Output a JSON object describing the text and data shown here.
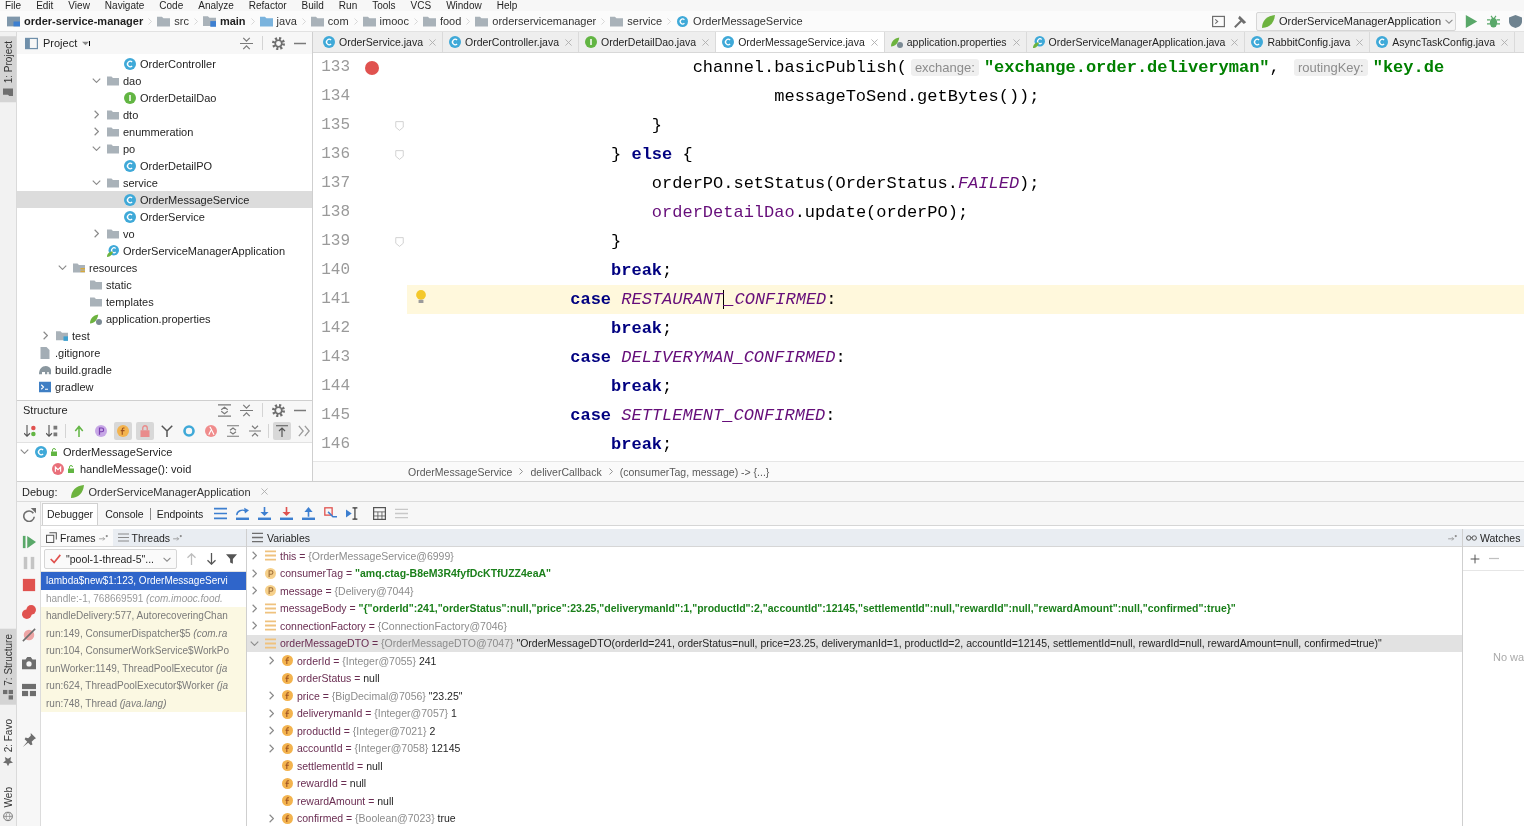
{
  "menu_bar": {
    "items": [
      "File",
      "Edit",
      "View",
      "Navigate",
      "Code",
      "Analyze",
      "Refactor",
      "Build",
      "Run",
      "Tools",
      "VCS",
      "Window",
      "Help"
    ]
  },
  "nav_bar": {
    "breadcrumbs": [
      {
        "label": "order-service-manager",
        "kind": "project"
      },
      {
        "label": "src",
        "kind": "package"
      },
      {
        "label": "main",
        "kind": "module"
      },
      {
        "label": "java",
        "kind": "source"
      },
      {
        "label": "com",
        "kind": "package"
      },
      {
        "label": "imooc",
        "kind": "package"
      },
      {
        "label": "food",
        "kind": "package"
      },
      {
        "label": "orderservicemanager",
        "kind": "package"
      },
      {
        "label": "service",
        "kind": "package"
      },
      {
        "label": "OrderMessageService",
        "kind": "class"
      }
    ],
    "run_config": "OrderServiceManagerApplication"
  },
  "tool_stripes": {
    "top": [
      {
        "label": "1: Project",
        "kind": "project",
        "selected": true
      }
    ],
    "bottom": [
      {
        "label": "7: Structure",
        "kind": "structure",
        "selected": true
      },
      {
        "label": "2: Favo",
        "kind": "favorites",
        "selected": false
      },
      {
        "label": "Web",
        "kind": "web",
        "selected": false
      }
    ]
  },
  "project_panel": {
    "title": "Project",
    "tree": [
      {
        "children": [
          {
            "children": [
              {
                "children": [
                  {
                    "children": [
                      {
                        "children": [
                          {
                            "label": "OrderController",
                            "kind": "class",
                            "selected": false
                          }
                        ]
                      },
                      {
                        "label": "dao",
                        "kind": "folder",
                        "expanded": true,
                        "selected": false,
                        "children": [
                          {
                            "label": "OrderDetailDao",
                            "kind": "interface",
                            "selected": false
                          }
                        ]
                      },
                      {
                        "label": "dto",
                        "kind": "folder",
                        "expanded": false,
                        "selected": false
                      },
                      {
                        "label": "enummeration",
                        "kind": "folder",
                        "expanded": false,
                        "selected": false
                      },
                      {
                        "label": "po",
                        "kind": "folder",
                        "expanded": true,
                        "selected": false,
                        "children": [
                          {
                            "label": "OrderDetailPO",
                            "kind": "class",
                            "selected": false
                          }
                        ]
                      },
                      {
                        "label": "service",
                        "kind": "folder",
                        "expanded": true,
                        "selected": false,
                        "children": [
                          {
                            "label": "OrderMessageService",
                            "kind": "class",
                            "selected": true
                          },
                          {
                            "label": "OrderService",
                            "kind": "class",
                            "selected": false
                          }
                        ]
                      },
                      {
                        "label": "vo",
                        "kind": "folder",
                        "expanded": false,
                        "selected": false
                      },
                      {
                        "label": "OrderServiceManagerApplication",
                        "kind": "application",
                        "selected": false
                      }
                    ]
                  }
                ]
              },
              {
                "label": "resources",
                "kind": "resources",
                "expanded": true,
                "selected": false,
                "children": [
                  {
                    "label": "static",
                    "kind": "folder",
                    "selected": false
                  },
                  {
                    "label": "templates",
                    "kind": "folder",
                    "selected": false
                  },
                  {
                    "label": "application.properties",
                    "kind": "properties",
                    "selected": false
                  }
                ]
              }
            ]
          },
          {
            "label": "test",
            "kind": "tests",
            "expanded": false,
            "selected": false
          }
        ]
      },
      {
        "label": ".gitignore",
        "kind": "text",
        "selected": false
      },
      {
        "label": "build.gradle",
        "kind": "gradle",
        "selected": false
      },
      {
        "label": "gradlew",
        "kind": "script",
        "selected": false
      }
    ]
  },
  "structure_panel": {
    "title": "Structure",
    "toolbar": [
      {
        "kind": "visibility",
        "on": false
      },
      {
        "kind": "alphabetical",
        "on": false
      },
      {
        "kind": "inherited",
        "on": false
      },
      {
        "kind": "properties",
        "on": false
      },
      {
        "kind": "fields",
        "on": true
      },
      {
        "kind": "nonpublic",
        "on": true
      },
      {
        "kind": "anonymous",
        "on": false
      },
      {
        "kind": "interfaces",
        "on": false
      },
      {
        "kind": "lambdas",
        "on": false
      },
      {
        "kind": "expand",
        "on": false
      },
      {
        "kind": "collapse",
        "on": false
      },
      {
        "kind": "autoscroll",
        "on": true
      },
      {
        "kind": "more",
        "on": false
      }
    ],
    "tree": [
      {
        "label": "OrderMessageService",
        "kind": "class",
        "expanded": true,
        "selected": false,
        "children": [
          {
            "label": "handleMessage(): void",
            "kind": "method",
            "selected": false
          }
        ]
      }
    ]
  },
  "editor": {
    "tabs": [
      {
        "label": "OrderService.java",
        "kind": "class",
        "selected": false
      },
      {
        "label": "OrderController.java",
        "kind": "class",
        "selected": false
      },
      {
        "label": "OrderDetailDao.java",
        "kind": "interface",
        "selected": false
      },
      {
        "label": "OrderMessageService.java",
        "kind": "class",
        "selected": true
      },
      {
        "label": "application.properties",
        "kind": "properties",
        "selected": false
      },
      {
        "label": "OrderServiceManagerApplication.java",
        "kind": "application",
        "selected": false
      },
      {
        "label": "RabbitConfig.java",
        "kind": "class",
        "selected": false
      },
      {
        "label": "AsyncTaskConfig.java",
        "kind": "class",
        "selected": false
      }
    ],
    "lines": [
      {
        "number": "133",
        "breakpoint": true,
        "fold": false,
        "current": false,
        "intention": false,
        "tokens": [
          {
            "text": "                            channel.basicPublish(",
            "kind": "plain"
          },
          {
            "text": "exchange:",
            "kind": "hint"
          },
          {
            "text": "\"exchange.order.deliveryman\"",
            "kind": "string"
          },
          {
            "text": ", ",
            "kind": "plain"
          },
          {
            "text": "routingKey:",
            "kind": "hint"
          },
          {
            "text": "\"key.de",
            "kind": "string"
          }
        ]
      },
      {
        "number": "134",
        "breakpoint": false,
        "fold": false,
        "current": false,
        "intention": false,
        "tokens": [
          {
            "text": "                                    messageToSend.getBytes());",
            "kind": "plain"
          }
        ]
      },
      {
        "number": "135",
        "breakpoint": false,
        "fold": true,
        "current": false,
        "intention": false,
        "tokens": [
          {
            "text": "                        }",
            "kind": "plain"
          }
        ]
      },
      {
        "number": "136",
        "breakpoint": false,
        "fold": true,
        "current": false,
        "intention": false,
        "tokens": [
          {
            "text": "                    } ",
            "kind": "plain"
          },
          {
            "text": "else",
            "kind": "keyword"
          },
          {
            "text": " {",
            "kind": "plain"
          }
        ]
      },
      {
        "number": "137",
        "breakpoint": false,
        "fold": false,
        "current": false,
        "intention": false,
        "tokens": [
          {
            "text": "                        orderPO.setStatus(OrderStatus.",
            "kind": "plain"
          },
          {
            "text": "FAILED",
            "kind": "constant"
          },
          {
            "text": ");",
            "kind": "plain"
          }
        ]
      },
      {
        "number": "138",
        "breakpoint": false,
        "fold": false,
        "current": false,
        "intention": false,
        "tokens": [
          {
            "text": "                        orderDetailDao",
            "kind": "field"
          },
          {
            "text": ".update(orderPO);",
            "kind": "plain"
          }
        ]
      },
      {
        "number": "139",
        "breakpoint": false,
        "fold": true,
        "current": false,
        "intention": false,
        "tokens": [
          {
            "text": "                    }",
            "kind": "plain"
          }
        ]
      },
      {
        "number": "140",
        "breakpoint": false,
        "fold": false,
        "current": false,
        "intention": false,
        "tokens": [
          {
            "text": "                    break",
            "kind": "keyword"
          },
          {
            "text": ";",
            "kind": "plain"
          }
        ]
      },
      {
        "number": "141",
        "breakpoint": false,
        "fold": false,
        "current": true,
        "intention": true,
        "tokens": [
          {
            "text": "                case ",
            "kind": "keyword"
          },
          {
            "text": "RESTAURANT",
            "kind": "constant",
            "caret": true
          },
          {
            "text": "_CONFIRMED",
            "kind": "constant"
          },
          {
            "text": ":",
            "kind": "plain"
          }
        ]
      },
      {
        "number": "142",
        "breakpoint": false,
        "fold": false,
        "current": false,
        "intention": false,
        "tokens": [
          {
            "text": "                    break",
            "kind": "keyword"
          },
          {
            "text": ";",
            "kind": "plain"
          }
        ]
      },
      {
        "number": "143",
        "breakpoint": false,
        "fold": false,
        "current": false,
        "intention": false,
        "tokens": [
          {
            "text": "                case ",
            "kind": "keyword"
          },
          {
            "text": "DELIVERYMAN_CONFIRMED",
            "kind": "constant"
          },
          {
            "text": ":",
            "kind": "plain"
          }
        ]
      },
      {
        "number": "144",
        "breakpoint": false,
        "fold": false,
        "current": false,
        "intention": false,
        "tokens": [
          {
            "text": "                    break",
            "kind": "keyword"
          },
          {
            "text": ";",
            "kind": "plain"
          }
        ]
      },
      {
        "number": "145",
        "breakpoint": false,
        "fold": false,
        "current": false,
        "intention": false,
        "tokens": [
          {
            "text": "                case ",
            "kind": "keyword"
          },
          {
            "text": "SETTLEMENT_CONFIRMED",
            "kind": "constant"
          },
          {
            "text": ":",
            "kind": "plain"
          }
        ]
      },
      {
        "number": "146",
        "breakpoint": false,
        "fold": false,
        "current": false,
        "intention": false,
        "tokens": [
          {
            "text": "                    break",
            "kind": "keyword"
          },
          {
            "text": ";",
            "kind": "plain"
          }
        ]
      }
    ],
    "breadcrumbs": [
      "OrderMessageService",
      "deliverCallback",
      "(consumerTag, message) -> {...}"
    ]
  },
  "debug": {
    "title": "Debug:",
    "session": "OrderServiceManagerApplication",
    "tabs": [
      {
        "label": "Debugger",
        "selected": true
      },
      {
        "label": "Console",
        "selected": false
      },
      {
        "label": "Endpoints",
        "selected": false
      }
    ],
    "frames": {
      "tabs": [
        {
          "label": "Frames",
          "kind": "frames",
          "selected": true
        },
        {
          "label": "Threads",
          "kind": "threads",
          "selected": false
        }
      ],
      "thread": "\"pool-1-thread-5\"...",
      "items": [
        {
          "text": "lambda$new$1:123, OrderMessageServi",
          "kind": "project",
          "selected": true
        },
        {
          "text": "handle:-1, 768669591 *(com.imooc.food.*",
          "kind": "synthetic",
          "selected": false
        },
        {
          "text": "handleDelivery:577, AutorecoveringChan",
          "kind": "library",
          "selected": false
        },
        {
          "text": "run:149, ConsumerDispatcher$5 *(com.ra*",
          "kind": "library",
          "selected": false
        },
        {
          "text": "run:104, ConsumerWorkService$WorkPo",
          "kind": "library",
          "selected": false
        },
        {
          "text": "runWorker:1149, ThreadPoolExecutor *(ja*",
          "kind": "library",
          "selected": false
        },
        {
          "text": "run:624, ThreadPoolExecutor$Worker *(ja*",
          "kind": "library",
          "selected": false
        },
        {
          "text": "run:748, Thread *(java.lang)*",
          "kind": "library",
          "selected": false
        }
      ]
    },
    "variables": {
      "title": "Variables",
      "items": [
        {
          "label": "this =",
          "ref": "{OrderMessageService@6999}",
          "kind": "object",
          "expanded": false,
          "selected": false
        },
        {
          "label": "consumerTag =",
          "value": "\"amq.ctag-B8eM3R4fyfDcKTfUZZ4eaA\"",
          "string_value": true,
          "kind": "parameter",
          "expanded": false,
          "selected": false
        },
        {
          "label": "message =",
          "ref": "{Delivery@7044}",
          "kind": "parameter",
          "expanded": false,
          "selected": false
        },
        {
          "label": "messageBody =",
          "value": "\"{\"orderId\":241,\"orderStatus\":null,\"price\":23.25,\"deliverymanId\":1,\"productId\":2,\"accountId\":12145,\"settlementId\":null,\"rewardId\":null,\"rewardAmount\":null,\"confirmed\":true}\"",
          "string_value": true,
          "kind": "object",
          "expanded": false,
          "selected": false
        },
        {
          "label": "connectionFactory =",
          "ref": "{ConnectionFactory@7046}",
          "kind": "object",
          "expanded": false,
          "selected": false
        },
        {
          "label": "orderMessageDTO =",
          "ref": "{OrderMessageDTO@7047}",
          "value": "\"OrderMessageDTO(orderId=241, orderStatus=null, price=23.25, deliverymanId=1, productId=2, accountId=12145, settlementId=null, rewardId=null, rewardAmount=null, confirmed=true)\"",
          "string_value": false,
          "kind": "object",
          "expanded": true,
          "selected": true,
          "children": [
            {
              "label": "orderId =",
              "ref": "{Integer@7055}",
              "value": "241",
              "string_value": false,
              "kind": "field",
              "expanded": false,
              "selected": false
            },
            {
              "label": "orderStatus =",
              "value": "null",
              "string_value": false,
              "kind": "field",
              "selected": false
            },
            {
              "label": "price =",
              "ref": "{BigDecimal@7056}",
              "value": "\"23.25\"",
              "string_value": false,
              "kind": "field",
              "expanded": false,
              "selected": false
            },
            {
              "label": "deliverymanId =",
              "ref": "{Integer@7057}",
              "value": "1",
              "string_value": false,
              "kind": "field",
              "expanded": false,
              "selected": false
            },
            {
              "label": "productId =",
              "ref": "{Integer@7021}",
              "value": "2",
              "string_value": false,
              "kind": "field",
              "expanded": false,
              "selected": false
            },
            {
              "label": "accountId =",
              "ref": "{Integer@7058}",
              "value": "12145",
              "string_value": false,
              "kind": "field",
              "expanded": false,
              "selected": false
            },
            {
              "label": "settlementId =",
              "value": "null",
              "string_value": false,
              "kind": "field",
              "selected": false
            },
            {
              "label": "rewardId =",
              "value": "null",
              "string_value": false,
              "kind": "field",
              "selected": false
            },
            {
              "label": "rewardAmount =",
              "value": "null",
              "string_value": false,
              "kind": "field",
              "selected": false
            },
            {
              "label": "confirmed =",
              "ref": "{Boolean@7023}",
              "value": "true",
              "string_value": false,
              "kind": "field",
              "expanded": false,
              "selected": false
            }
          ]
        }
      ]
    },
    "watches": {
      "title": "Watches",
      "empty_text": "No wa"
    }
  }
}
